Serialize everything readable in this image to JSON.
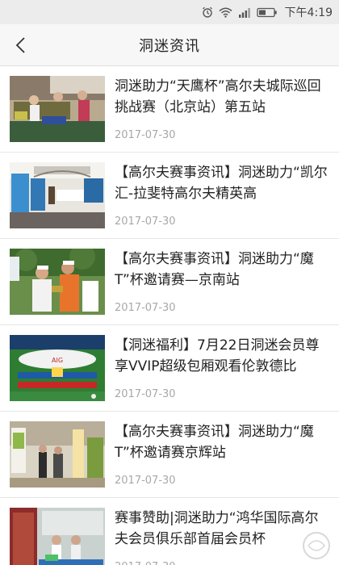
{
  "status_bar": {
    "time": "下午4:19",
    "icons": [
      "alarm-icon",
      "wifi-icon",
      "signal-icon",
      "battery-icon"
    ]
  },
  "header": {
    "back_icon": "chevron-left-icon",
    "title": "洞迷资讯"
  },
  "articles": [
    {
      "title": "洞迷助力“天鹰杯”高尔夫城际巡回挑战赛（北京站）第五站",
      "date": "2017-07-30",
      "thumb": "outdoor-table-photo"
    },
    {
      "title": "【高尔夫赛事资讯】洞迷助力“凯尔汇-拉斐特高尔夫精英高",
      "date": "2017-07-30",
      "thumb": "clubhouse-event-photo"
    },
    {
      "title": "【高尔夫赛事资讯】洞迷助力“魔T”杯邀请赛—京南站",
      "date": "2017-07-30",
      "thumb": "golfers-photo"
    },
    {
      "title": "【洞迷福利】7月22日洞迷会员尊享VVIP超级包厢观看伦敦德比",
      "date": "2017-07-30",
      "thumb": "stadium-photo"
    },
    {
      "title": "【高尔夫赛事资讯】洞迷助力“魔T”杯邀请赛京辉站",
      "date": "2017-07-30",
      "thumb": "lobby-event-photo"
    },
    {
      "title": "赛事赞助|洞迷助力“鸿华国际高尔夫会员俱乐部首届会员杯",
      "date": "2017-07-30",
      "thumb": "award-desk-photo"
    }
  ]
}
